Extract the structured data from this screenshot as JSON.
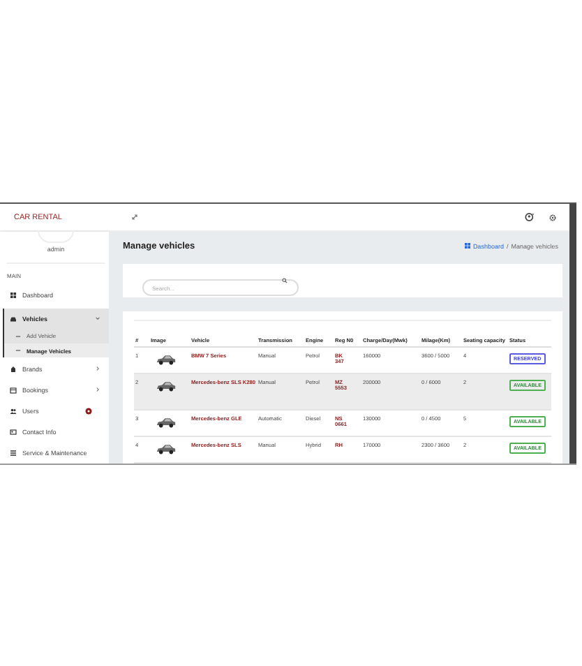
{
  "navbar": {
    "brand": "CAR RENTAL"
  },
  "sidebar": {
    "user": "admin",
    "section": "MAIN",
    "items": [
      {
        "label": "Dashboard",
        "selected": false
      },
      {
        "label": "Vehicles",
        "selected": true,
        "expanded": true,
        "children": [
          {
            "label": "Add Vehicle",
            "selected": false
          },
          {
            "label": "Manage Vehicles",
            "selected": true
          }
        ]
      },
      {
        "label": "Brands",
        "selected": false,
        "expanded": false
      },
      {
        "label": "Bookings",
        "selected": false,
        "expanded": false
      },
      {
        "label": "Users",
        "selected": false,
        "badge": true
      },
      {
        "label": "Contact Info",
        "selected": false
      },
      {
        "label": "Service & Maintenance",
        "selected": false
      }
    ]
  },
  "page": {
    "title": "Manage vehicles",
    "breadcrumb": {
      "items": [
        "Dashboard",
        "Manage vehicles"
      ],
      "separator": "/"
    }
  },
  "search": {
    "placeholder": "Search..."
  },
  "table": {
    "columns": [
      "#",
      "Image",
      "Vehicle",
      "Transmission",
      "Engine",
      "Reg N0",
      "Charge/Day(Mwk)",
      "Milage(Km)",
      "Seating capacity",
      "Status"
    ],
    "rows": [
      {
        "selected": false,
        "number": "1",
        "vehicle": "BMW 7 Series",
        "transmission": "Manual",
        "engine": "Petrol",
        "reg": "BK 347",
        "charge": "160000",
        "milage": "3600 / 5000",
        "seats": "4",
        "status": {
          "kind": "reserved",
          "label": "RESERVED"
        }
      },
      {
        "selected": true,
        "number": "2",
        "vehicle": "Mercedes-benz SLS K280",
        "transmission": "Manual",
        "engine": "Petrol",
        "reg": "MZ 5553",
        "charge": "200000",
        "milage": "0 / 6000",
        "seats": "2",
        "status": {
          "kind": "available",
          "label": "AVAILABLE"
        }
      },
      {
        "selected": false,
        "number": "3",
        "vehicle": "Mercedes-benz GLE",
        "transmission": "Automatic",
        "engine": "Diesel",
        "reg": "NS 0661",
        "charge": "130000",
        "milage": "0 / 4500",
        "seats": "5",
        "status": {
          "kind": "available",
          "label": "AVAILABLE"
        }
      },
      {
        "selected": false,
        "number": "4",
        "vehicle": "Mercedes-benz SLS",
        "transmission": "Manual",
        "engine": "Hybrid",
        "reg": "RH",
        "charge": "170000",
        "milage": "2300 / 3600",
        "seats": "2",
        "status": {
          "kind": "available",
          "label": "AVAILABLE"
        }
      }
    ]
  }
}
